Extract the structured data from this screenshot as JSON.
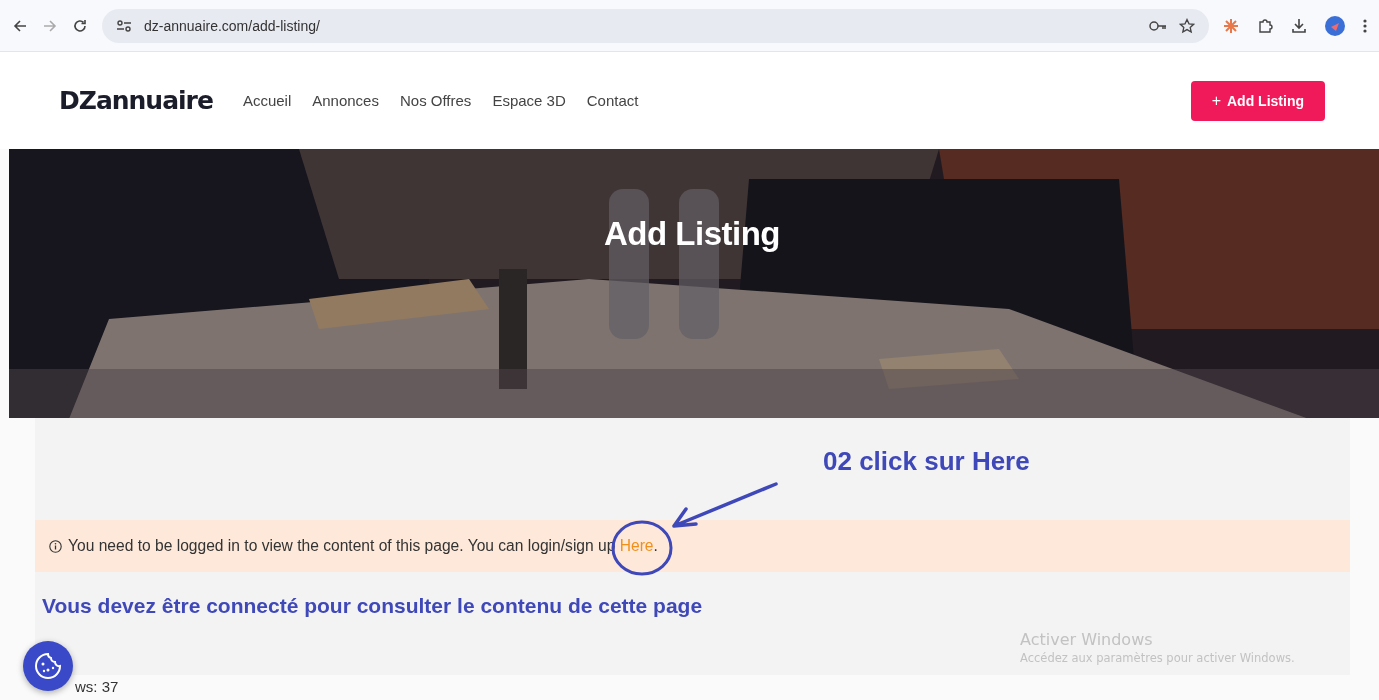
{
  "browser": {
    "url": "dz-annuaire.com/add-listing/"
  },
  "header": {
    "logo": "DZannuaire",
    "nav": [
      {
        "label": "Accueil"
      },
      {
        "label": "Annonces"
      },
      {
        "label": "Nos Offres"
      },
      {
        "label": "Espace 3D"
      },
      {
        "label": "Contact"
      }
    ],
    "cta": {
      "icon": "+",
      "label": "Add Listing"
    }
  },
  "hero": {
    "kind": "picture",
    "title": "Add Listing"
  },
  "notice": {
    "message": "You need to be logged in to view the content of this page. You can login/sign up ",
    "link": "Here",
    "end": "."
  },
  "annotations": {
    "step": "02 click sur Here",
    "caption": "Vous devez être connecté pour consulter le contenu de cette page"
  },
  "footer": {
    "views": "ws: 37"
  },
  "os_overlay": {
    "title": "Activer Windows",
    "subtitle": "Accédez aux paramètres pour activer Windows."
  }
}
